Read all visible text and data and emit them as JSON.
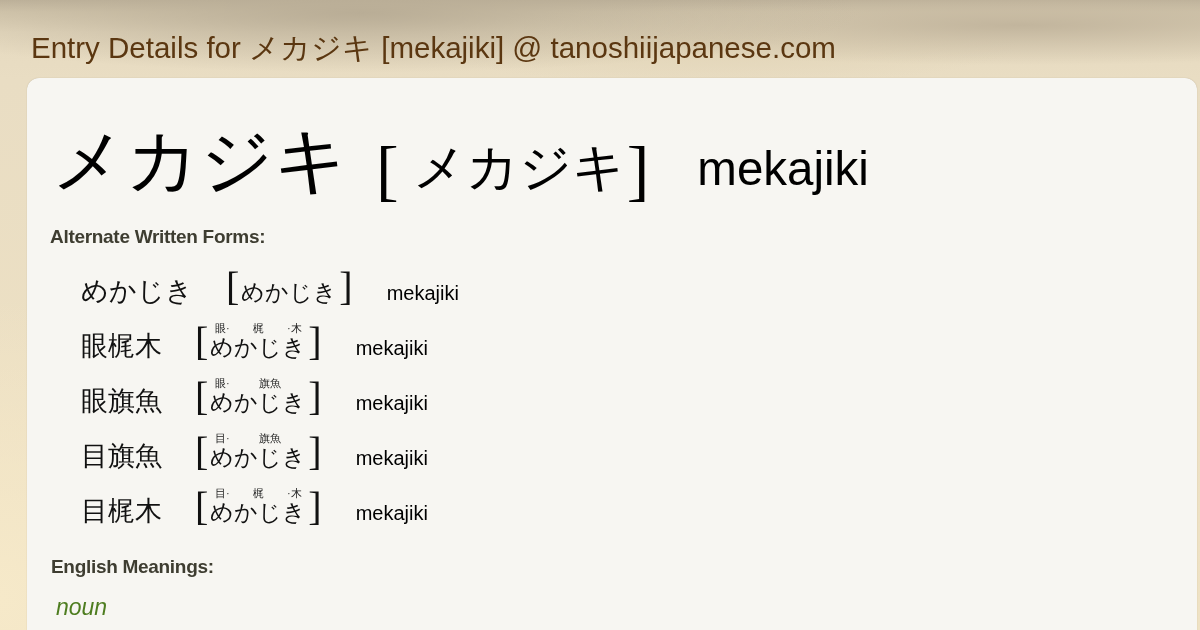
{
  "page_title": "Entry Details for メカジキ [mekajiki] @ tanoshiijapanese.com",
  "entry": {
    "writing": "メカジキ",
    "open_bracket": "[",
    "reading": "メカジキ",
    "close_bracket": "]",
    "romaji": "mekajiki"
  },
  "alternate_forms": {
    "heading": "Alternate Written Forms:",
    "items": [
      {
        "writing": "めかじき",
        "open_bracket": "[",
        "reading": [
          {
            "kana": "めかじき"
          }
        ],
        "close_bracket": "]",
        "romaji": "mekajiki"
      },
      {
        "writing": "眼梶木",
        "open_bracket": "[",
        "reading": [
          {
            "furigana": "眼·",
            "kana": "め"
          },
          {
            "furigana": "梶",
            "kana": "かじ"
          },
          {
            "furigana": "·木",
            "kana": "き"
          }
        ],
        "close_bracket": "]",
        "romaji": "mekajiki"
      },
      {
        "writing": "眼旗魚",
        "open_bracket": "[",
        "reading": [
          {
            "furigana": "眼·",
            "kana": "め"
          },
          {
            "furigana": "旗魚",
            "kana": "かじき"
          }
        ],
        "close_bracket": "]",
        "romaji": "mekajiki"
      },
      {
        "writing": "目旗魚",
        "open_bracket": "[",
        "reading": [
          {
            "furigana": "目·",
            "kana": "め"
          },
          {
            "furigana": "旗魚",
            "kana": "かじき"
          }
        ],
        "close_bracket": "]",
        "romaji": "mekajiki"
      },
      {
        "writing": "目梶木",
        "open_bracket": "[",
        "reading": [
          {
            "furigana": "目·",
            "kana": "め"
          },
          {
            "furigana": "梶",
            "kana": "かじ"
          },
          {
            "furigana": "·木",
            "kana": "き"
          }
        ],
        "close_bracket": "]",
        "romaji": "mekajiki"
      }
    ]
  },
  "meanings": {
    "heading": "English Meanings:",
    "part_of_speech": "noun"
  }
}
